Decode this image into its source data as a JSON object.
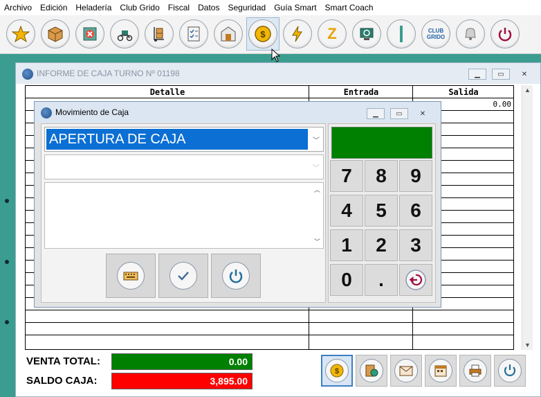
{
  "menu": [
    "Archivo",
    "Edición",
    "Heladería",
    "Club Grido",
    "Fiscal",
    "Datos",
    "Seguridad",
    "Guía Smart",
    "Smart Coach"
  ],
  "toolbar": {
    "buttons": [
      {
        "icon": "star-icon",
        "color": "#f5b400"
      },
      {
        "icon": "box-icon",
        "color": "#c47a20"
      },
      {
        "icon": "cancel-box-icon",
        "color": "#c0392b"
      },
      {
        "icon": "delivery-scooter-icon",
        "color": "#2a7d6d"
      },
      {
        "icon": "hand-truck-icon",
        "color": "#c47a20"
      },
      {
        "icon": "checklist-icon",
        "color": "#2a6fb5"
      },
      {
        "icon": "warehouse-icon",
        "color": "#8a6d3b"
      },
      {
        "icon": "cash-movement-icon",
        "color": "#e0a000"
      },
      {
        "icon": "lightning-icon",
        "color": "#f0b400"
      },
      {
        "icon": "z-report-icon",
        "color": "#e8a000",
        "text": "Z"
      },
      {
        "icon": "sync-icon",
        "color": "#2a7d6d"
      },
      {
        "icon": "divider-bar-icon",
        "color": "#3a9d8f"
      },
      {
        "icon": "club-grido-icon",
        "color": "#1f5fa8",
        "text": "CLUB GRIDO"
      },
      {
        "icon": "bell-icon",
        "color": "#8a8a8a"
      },
      {
        "icon": "power-icon",
        "color": "#a01040"
      }
    ]
  },
  "main_window": {
    "title": "INFORME DE CAJA TURNO Nº 01198",
    "columns": [
      "Detalle",
      "Entrada",
      "Salida"
    ],
    "first_row_salida": "0.00",
    "venta_total_label": "VENTA TOTAL:",
    "venta_total_value": "0.00",
    "saldo_caja_label": "SALDO CAJA:",
    "saldo_caja_value": "3,895.00",
    "colors": {
      "green": "#008000",
      "red": "#ff0000"
    }
  },
  "bottom_buttons": [
    {
      "icon": "cash-movement-icon"
    },
    {
      "icon": "money-report-icon"
    },
    {
      "icon": "envelope-icon"
    },
    {
      "icon": "calendar-icon"
    },
    {
      "icon": "printer-icon"
    },
    {
      "icon": "power-icon"
    }
  ],
  "dialog": {
    "title": "Movimiento de Caja",
    "selected_type": "APERTURA DE CAJA",
    "second_value": "",
    "memo": "",
    "display": "",
    "keys": [
      "7",
      "8",
      "9",
      "4",
      "5",
      "6",
      "1",
      "2",
      "3",
      "0",
      "."
    ]
  }
}
